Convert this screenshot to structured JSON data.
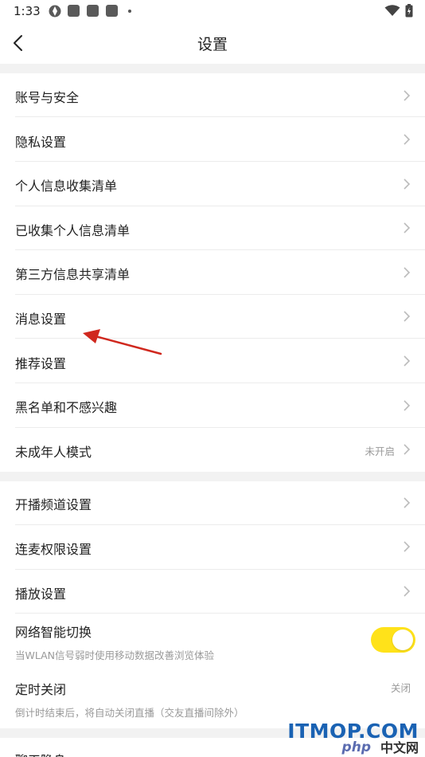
{
  "status_bar": {
    "time": "1:33"
  },
  "nav": {
    "title": "设置"
  },
  "groups": {
    "account": [
      "账号与安全",
      "隐私设置",
      "个人信息收集清单",
      "已收集个人信息清单",
      "第三方信息共享清单",
      "消息设置",
      "推荐设置",
      "黑名单和不感兴趣"
    ],
    "minor_mode": {
      "label": "未成年人模式",
      "value": "未开启"
    },
    "live": [
      "开播频道设置",
      "连麦权限设置",
      "播放设置"
    ],
    "network": {
      "label": "网络智能切换",
      "desc": "当WLAN信号弱时使用移动数据改善浏览体验",
      "enabled": true
    },
    "timer": {
      "label": "定时关闭",
      "value": "关闭",
      "desc": "倒计时结束后，将自动关闭直播（交友直播间除外）"
    },
    "partial": {
      "label": "聊天隐身"
    }
  },
  "annotation": {
    "color": "#d0281e"
  },
  "watermark": {
    "main": "ITMOP.COM",
    "php": "php",
    "cn": "中文网"
  },
  "colors": {
    "toggle_on": "#ffe21a",
    "section_gap": "#f2f2f2"
  }
}
